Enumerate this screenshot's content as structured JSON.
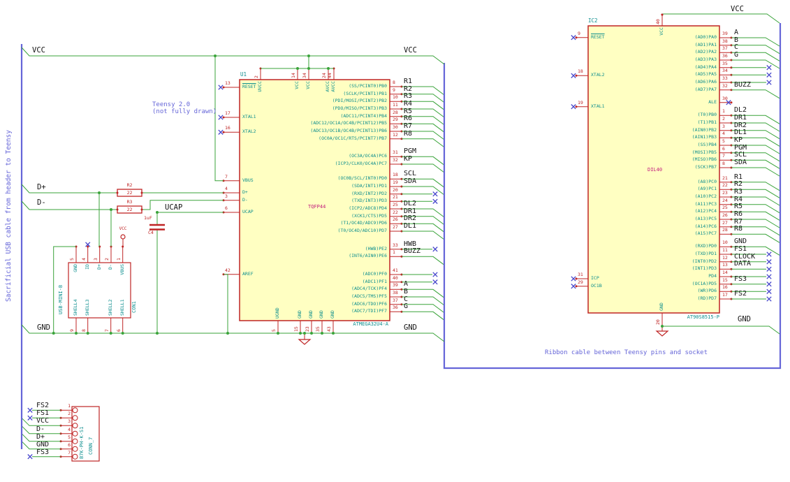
{
  "notes": {
    "left_vertical": "Sacrificial USB cable from header to Teensy",
    "teensy_1": "Teensy 2.0",
    "teensy_2": "(not fully drawn)",
    "ribbon": "Ribbon cable between Teensy pins and socket"
  },
  "labels": {
    "vcc": "VCC",
    "gnd": "GND",
    "dplus": "D+",
    "dminus": "D-",
    "ucap": "UCAP"
  },
  "colors": {
    "wire": "#3aa33a",
    "bus": "#6565d8",
    "component": "#bf2424",
    "pin_name": "#0d8e8e",
    "footprint": "#c21b7c",
    "no_connect": "#4848cc",
    "label": "#141414",
    "body_fill": "#ffffc2"
  },
  "u1": {
    "ref": "U1",
    "value": "ATMEGA32U4-A",
    "footprint": "TQFP44",
    "left_pins": [
      {
        "num": "13",
        "name": "RESET",
        "overline": true,
        "nc": true
      },
      {
        "num": "17",
        "name": "XTAL1",
        "nc": true
      },
      {
        "num": "16",
        "name": "XTAL2",
        "nc": true
      },
      {
        "num": "7",
        "name": "VBUS"
      },
      {
        "num": "4",
        "name": "D+"
      },
      {
        "num": "3",
        "name": "D-"
      },
      {
        "num": "6",
        "name": "UCAP"
      },
      {
        "num": "42",
        "name": "AREF"
      }
    ],
    "right_pins": [
      {
        "num": "8",
        "name": "(SS/PCINT0)PB0",
        "net": "R1",
        "conn": "bus"
      },
      {
        "num": "9",
        "name": "(SCLK/PCINT1)PB1",
        "net": "R2",
        "conn": "bus"
      },
      {
        "num": "10",
        "name": "(PDI/MOSI/PCINT2)PB2",
        "net": "R3",
        "conn": "bus"
      },
      {
        "num": "11",
        "name": "(PDO/MISO/PCINT3)PB3",
        "net": "R4",
        "conn": "bus"
      },
      {
        "num": "28",
        "name": "(ADC11/PCINT4)PB4",
        "net": "R5",
        "conn": "bus"
      },
      {
        "num": "29",
        "name": "(ADC12/OC1A/OC4B/PCINT12)PB5",
        "net": "R6",
        "conn": "bus"
      },
      {
        "num": "30",
        "name": "(ADC13/OC1B/OC4B/PCINT13)PB6",
        "net": "R7",
        "conn": "bus"
      },
      {
        "num": "12",
        "name": "(OC0A/OC1C/RTS/PCINT7)PB7",
        "net": "R8",
        "conn": "bus"
      },
      {
        "num": "31",
        "name": "(OC3A/OC4A)PC6",
        "net": "PGM",
        "conn": "bus"
      },
      {
        "num": "32",
        "name": "(ICP3/CLK0/OC4A)PC7",
        "net": "KP",
        "conn": "bus"
      },
      {
        "num": "18",
        "name": "(OC0B/SCL/INT0)PD0",
        "net": "SCL",
        "conn": "bus"
      },
      {
        "num": "19",
        "name": "(SDA/INT1)PD1",
        "net": "SDA",
        "conn": "bus"
      },
      {
        "num": "20",
        "name": "(RXD/INT2)PD2",
        "net": "",
        "conn": "nc"
      },
      {
        "num": "21",
        "name": "(TXD/INT3)PD3",
        "net": "",
        "conn": "nc"
      },
      {
        "num": "25",
        "name": "(ICP2/ADC8)PD4",
        "net": "DL2",
        "conn": "bus"
      },
      {
        "num": "22",
        "name": "(XCK1/CTS)PD5",
        "net": "DR1",
        "conn": "bus"
      },
      {
        "num": "26",
        "name": "(T1/OC4D/ADC9)PD6",
        "net": "DR2",
        "conn": "bus"
      },
      {
        "num": "27",
        "name": "(T0/OC4D/ADC10)PD7",
        "net": "DL1",
        "conn": "bus"
      },
      {
        "num": "33",
        "name": "(HWB)PE2",
        "net": "HWB",
        "conn": "nc"
      },
      {
        "num": "1",
        "name": "(INT6/AIN0)PE6",
        "net": "BUZZ",
        "conn": "bus"
      },
      {
        "num": "41",
        "name": "(ADC0)PF0",
        "net": "",
        "conn": "nc"
      },
      {
        "num": "40",
        "name": "(ADC1)PF1",
        "net": "",
        "conn": "nc"
      },
      {
        "num": "39",
        "name": "(ADC4/TCK)PF4",
        "net": "A",
        "conn": "bus"
      },
      {
        "num": "38",
        "name": "(ADC5/TMS)PF5",
        "net": "B",
        "conn": "bus"
      },
      {
        "num": "37",
        "name": "(ADC6/TDO)PF6",
        "net": "C",
        "conn": "bus"
      },
      {
        "num": "36",
        "name": "(ADC7/TDI)PF7",
        "net": "G",
        "conn": "bus"
      }
    ],
    "top_pins": [
      {
        "num": "2",
        "name": "UVCC"
      },
      {
        "num": "14",
        "name": "VCC"
      },
      {
        "num": "34",
        "name": "VCC"
      },
      {
        "num": "24",
        "name": "AVCC"
      },
      {
        "num": "44",
        "name": "AVCC"
      }
    ],
    "bottom_pins": [
      {
        "num": "5",
        "name": "UGND"
      },
      {
        "num": "15",
        "name": "GND"
      },
      {
        "num": "23",
        "name": "GND"
      },
      {
        "num": "35",
        "name": "GND"
      },
      {
        "num": "43",
        "name": "GND"
      }
    ]
  },
  "ic2": {
    "ref": "IC2",
    "value": "AT90S8515-P",
    "footprint": "DIL40",
    "left_pins": [
      {
        "num": "9",
        "name": "RESET",
        "overline": true,
        "nc": true
      },
      {
        "num": "18",
        "name": "XTAL2",
        "nc": true
      },
      {
        "num": "19",
        "name": "XTAL1",
        "nc": true
      },
      {
        "num": "31",
        "name": "ICP",
        "nc": true
      },
      {
        "num": "29",
        "name": "OC1B",
        "nc": true
      }
    ],
    "right_pins": [
      {
        "num": "39",
        "name": "(AD0)PA0",
        "net": "A",
        "conn": "bus"
      },
      {
        "num": "38",
        "name": "(AD1)PA1",
        "net": "B",
        "conn": "bus"
      },
      {
        "num": "37",
        "name": "(AD2)PA2",
        "net": "C",
        "conn": "bus"
      },
      {
        "num": "36",
        "name": "(AD3)PA3",
        "net": "G",
        "conn": "bus"
      },
      {
        "num": "35",
        "name": "(AD4)PA4",
        "net": "",
        "conn": "nc"
      },
      {
        "num": "34",
        "name": "(AD5)PA5",
        "net": "",
        "conn": "nc"
      },
      {
        "num": "33",
        "name": "(AD6)PA6",
        "net": "",
        "conn": "nc"
      },
      {
        "num": "32",
        "name": "(AD7)PA7",
        "net": "BUZZ",
        "conn": "bus"
      },
      {
        "num": "30",
        "name": "ALE",
        "net": "",
        "conn": "nc",
        "short": true
      },
      {
        "num": "1",
        "name": "(T0)PB0",
        "net": "DL2",
        "conn": "bus"
      },
      {
        "num": "2",
        "name": "(T1)PB1",
        "net": "DR1",
        "conn": "bus"
      },
      {
        "num": "3",
        "name": "(AIN0)PB2",
        "net": "DR2",
        "conn": "bus"
      },
      {
        "num": "4",
        "name": "(AIN1)PB3",
        "net": "DL1",
        "conn": "bus"
      },
      {
        "num": "5",
        "name": "(SS)PB4",
        "net": "KP",
        "conn": "bus"
      },
      {
        "num": "6",
        "name": "(MOSI)PB5",
        "net": "PGM",
        "conn": "bus"
      },
      {
        "num": "7",
        "name": "(MISO)PB6",
        "net": "SCL",
        "conn": "bus"
      },
      {
        "num": "8",
        "name": "(SCK)PB7",
        "net": "SDA",
        "conn": "bus"
      },
      {
        "num": "21",
        "name": "(A8)PC0",
        "net": "R1",
        "conn": "bus"
      },
      {
        "num": "22",
        "name": "(A9)PC1",
        "net": "R2",
        "conn": "bus"
      },
      {
        "num": "23",
        "name": "(A10)PC2",
        "net": "R3",
        "conn": "bus"
      },
      {
        "num": "24",
        "name": "(A11)PC3",
        "net": "R4",
        "conn": "bus"
      },
      {
        "num": "25",
        "name": "(A12)PC4",
        "net": "R5",
        "conn": "bus"
      },
      {
        "num": "26",
        "name": "(A13)PC5",
        "net": "R6",
        "conn": "bus"
      },
      {
        "num": "27",
        "name": "(A14)PC6",
        "net": "R7",
        "conn": "bus"
      },
      {
        "num": "28",
        "name": "(A15)PC7",
        "net": "R8",
        "conn": "bus"
      },
      {
        "num": "10",
        "name": "(RXD)PD0",
        "net": "GND",
        "conn": "bus"
      },
      {
        "num": "11",
        "name": "(TXD)PD1",
        "net": "FS1",
        "conn": "nc"
      },
      {
        "num": "12",
        "name": "(INT0)PD2",
        "net": "CLOCK",
        "conn": "nc"
      },
      {
        "num": "13",
        "name": "(INT1)PD3",
        "net": "DATA",
        "conn": "nc"
      },
      {
        "num": "14",
        "name": "PD4",
        "net": "",
        "conn": "nc"
      },
      {
        "num": "15",
        "name": "(OC1A)PD5",
        "net": "FS3",
        "conn": "nc"
      },
      {
        "num": "16",
        "name": "(WR)PD6",
        "net": "",
        "conn": "nc"
      },
      {
        "num": "17",
        "name": "(RD)PD7",
        "net": "FS2",
        "conn": "nc"
      }
    ],
    "top_pins": [
      {
        "num": "40",
        "name": "VCC"
      }
    ],
    "bottom_pins": [
      {
        "num": "20",
        "name": "GND"
      }
    ]
  },
  "con1": {
    "ref": "CON1",
    "value": "USB-MINI-B",
    "top_pins": [
      {
        "num": "5",
        "name": "GND"
      },
      {
        "num": "4",
        "name": "ID",
        "nc": true
      },
      {
        "num": "3",
        "name": "D+"
      },
      {
        "num": "2",
        "name": "D-"
      },
      {
        "num": "1",
        "name": "VBUS"
      }
    ],
    "bottom_pins": [
      {
        "num": "9",
        "name": "SHELL4"
      },
      {
        "num": "8",
        "name": "SHELL3"
      },
      {
        "num": "7",
        "name": "SHELL2"
      },
      {
        "num": "6",
        "name": "SHELL1"
      }
    ]
  },
  "conn7": {
    "ref": "CONN_7",
    "value": "B7K-PH-K-S1",
    "pins": [
      {
        "num": "1",
        "net": "FS2",
        "nc": true
      },
      {
        "num": "2",
        "net": "FS1",
        "nc": true
      },
      {
        "num": "3",
        "net": "VCC"
      },
      {
        "num": "4",
        "net": "D-"
      },
      {
        "num": "5",
        "net": "D+"
      },
      {
        "num": "6",
        "net": "GND"
      },
      {
        "num": "7",
        "net": "FS3",
        "nc": true
      }
    ]
  },
  "r2": {
    "ref": "R2",
    "value": "22"
  },
  "r3": {
    "ref": "R3",
    "value": "22"
  },
  "c4": {
    "ref": "C4",
    "value": "1uF"
  }
}
